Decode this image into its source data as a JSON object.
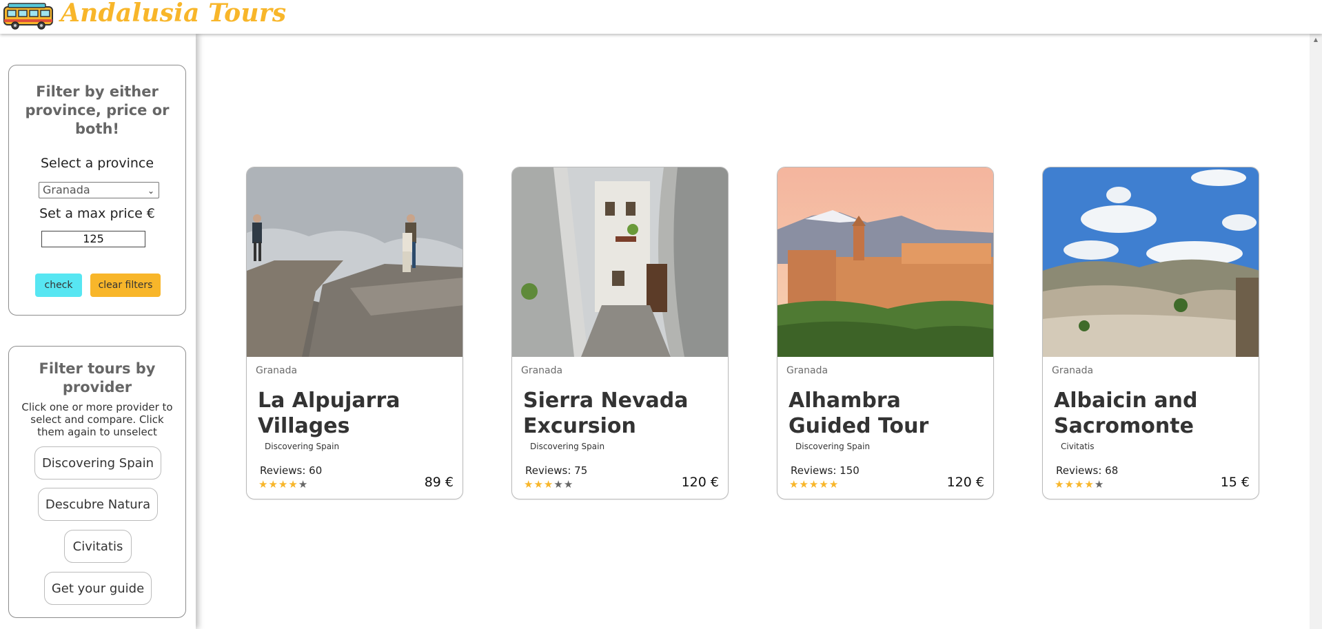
{
  "header": {
    "brand": "Andalusia Tours",
    "logo_icon": "bus-icon"
  },
  "filter_panel": {
    "title": "Filter by either province, price or both!",
    "province_label": "Select a province",
    "province_selected": "Granada",
    "price_label": "Set a max price €",
    "max_price_value": "125",
    "check_label": "check",
    "clear_label": "clear filters"
  },
  "provider_panel": {
    "title": "Filter tours by provider",
    "description": "Click one or more provider to select and compare. Click them again to unselect",
    "providers": [
      "Discovering Spain",
      "Descubre Natura",
      "Civitatis",
      "Get your guide"
    ]
  },
  "tours": [
    {
      "province": "Granada",
      "title": "La Alpujarra Villages",
      "provider": "Discovering Spain",
      "reviews": "Reviews: 60",
      "rating": 4,
      "price": "89 €"
    },
    {
      "province": "Granada",
      "title": "Sierra Nevada Excursion",
      "provider": "Discovering Spain",
      "reviews": "Reviews: 75",
      "rating": 3,
      "price": "120 €"
    },
    {
      "province": "Granada",
      "title": "Alhambra Guided Tour",
      "provider": "Discovering Spain",
      "reviews": "Reviews: 150",
      "rating": 5,
      "price": "120 €"
    },
    {
      "province": "Granada",
      "title": "Albaicin and Sacromonte",
      "provider": "Civitatis",
      "reviews": "Reviews: 68",
      "rating": 4,
      "price": "15 €"
    }
  ],
  "colors": {
    "brand": "#f8b62a",
    "check": "#57e6f2",
    "star_on": "#f8b62a",
    "star_off": "#666666"
  }
}
